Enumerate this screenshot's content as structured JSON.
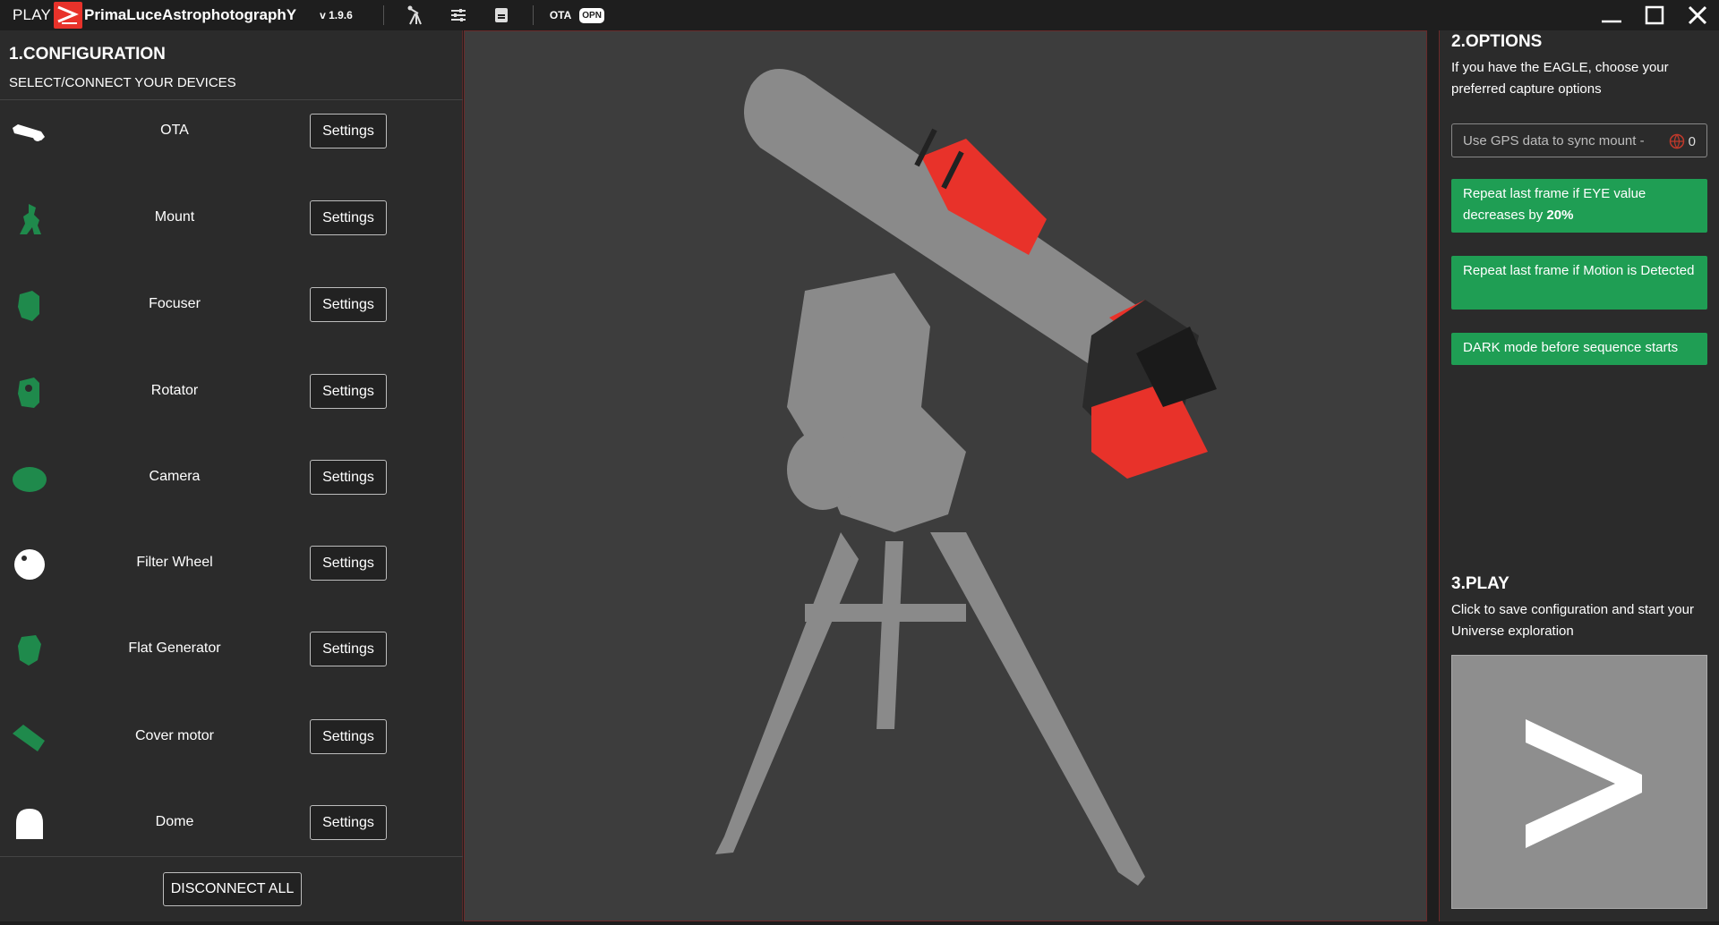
{
  "topbar": {
    "play_label": "PLAY",
    "app_name": "PrimaLuceAstrophotographY",
    "version": "v 1.9.6",
    "ota_label": "OTA",
    "opn_badge": "OPN",
    "icons": [
      "telescope-icon",
      "sliders-icon",
      "document-icon"
    ]
  },
  "configuration": {
    "title": "1.CONFIGURATION",
    "subtitle": "SELECT/CONNECT YOUR DEVICES",
    "settings_label": "Settings",
    "devices": [
      {
        "name": "OTA",
        "icon": "ota-icon",
        "color": "#ffffff"
      },
      {
        "name": "Mount",
        "icon": "mount-icon",
        "color": "#1f8a4c"
      },
      {
        "name": "Focuser",
        "icon": "focuser-icon",
        "color": "#1f8a4c"
      },
      {
        "name": "Rotator",
        "icon": "rotator-icon",
        "color": "#1f8a4c"
      },
      {
        "name": "Camera",
        "icon": "camera-icon",
        "color": "#1f8a4c"
      },
      {
        "name": "Filter Wheel",
        "icon": "filter-wheel-icon",
        "color": "#ffffff"
      },
      {
        "name": "Flat Generator",
        "icon": "flat-generator-icon",
        "color": "#1f8a4c"
      },
      {
        "name": "Cover motor",
        "icon": "cover-motor-icon",
        "color": "#1f8a4c"
      },
      {
        "name": "Dome",
        "icon": "dome-icon",
        "color": "#ffffff"
      }
    ],
    "disconnect_label": "DISCONNECT ALL"
  },
  "options": {
    "title": "2.OPTIONS",
    "description": "If you have the EAGLE, choose your preferred capture options",
    "gps_label": "Use GPS data to sync mount -",
    "gps_count": "0",
    "repeat_eye_text": "Repeat last frame if EYE value decreases by ",
    "repeat_eye_value": "20%",
    "repeat_motion": "Repeat last frame if Motion is Detected",
    "dark_mode": "DARK mode before sequence starts"
  },
  "play": {
    "title": "3.PLAY",
    "description": "Click to save configuration and start your Universe exploration"
  },
  "colors": {
    "accent_green": "#1f9e54",
    "device_green": "#1f8a4c",
    "brand_red": "#e8322a",
    "panel_bg": "#2b2b2b",
    "viewer_bg": "#3d3d3d"
  }
}
